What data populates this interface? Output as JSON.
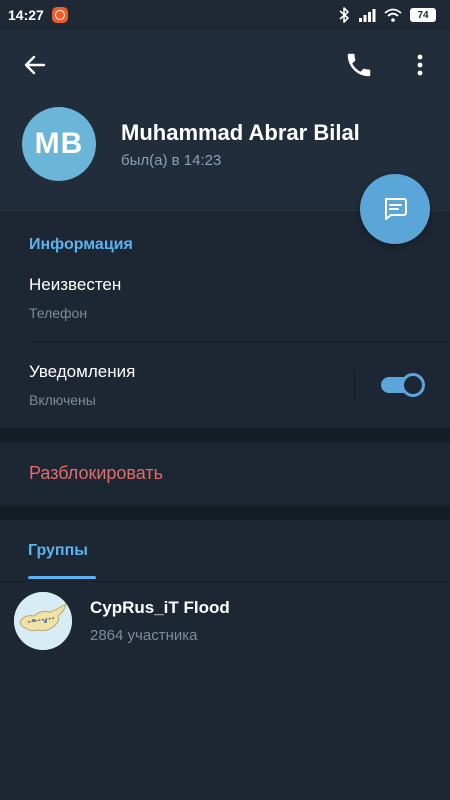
{
  "status_bar": {
    "time": "14:27",
    "battery": "74",
    "icons": [
      "bluetooth-icon",
      "signal-icon",
      "wifi-icon",
      "battery-icon"
    ]
  },
  "header": {
    "back_icon": "arrow-left-icon",
    "call_icon": "phone-icon",
    "more_icon": "more-vert-icon"
  },
  "profile": {
    "initials": "MB",
    "name": "Muhammad Abrar Bilal",
    "status": "был(а) в 14:23",
    "avatar_color": "#6bb5d9"
  },
  "fab": {
    "icon": "message-icon"
  },
  "info": {
    "title": "Информация",
    "phone_value": "Неизвестен",
    "phone_label": "Телефон",
    "notifications_label": "Уведомления",
    "notifications_state": "Включены",
    "notifications_enabled": true
  },
  "unblock": {
    "label": "Разблокировать",
    "color": "#e56a6a"
  },
  "groups": {
    "tab_label": "Группы",
    "items": [
      {
        "name": "CypRus_iT Flood",
        "members": "2864 участника",
        "avatar_icon": "cyprus-map-icon"
      }
    ]
  },
  "colors": {
    "accent": "#5ab3f0",
    "background": "#1d2733",
    "header": "#212d3b",
    "danger": "#e56a6a"
  }
}
